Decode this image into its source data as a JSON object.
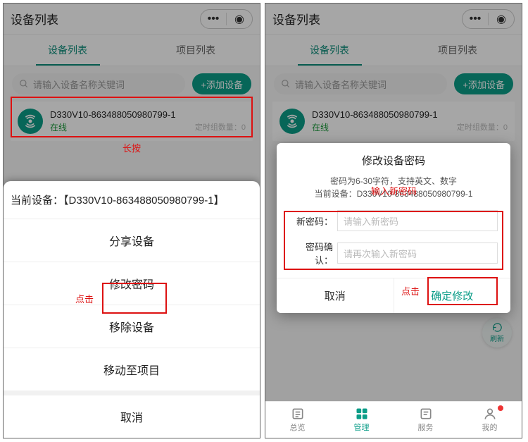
{
  "header": {
    "title": "设备列表"
  },
  "tabs": {
    "device": "设备列表",
    "project": "项目列表"
  },
  "search": {
    "placeholder": "请输入设备名称关键词"
  },
  "addButton": {
    "label": "+添加设备"
  },
  "device": {
    "name": "D330V10-863488050980799-1",
    "status": "在线",
    "timerLabel": "定时组数量：0"
  },
  "annotations": {
    "longPress": "长按",
    "click": "点击",
    "inputNewPwd": "输入新密码"
  },
  "sheet": {
    "titlePrefix": "当前设备：【",
    "titleName": "D330V10-863488050980799-1",
    "titleSuffix": "】",
    "share": "分享设备",
    "changePwd": "修改密码",
    "remove": "移除设备",
    "moveToProject": "移动至项目",
    "cancel": "取消"
  },
  "modal": {
    "title": "修改设备密码",
    "hintLine1": "密码为6-30字符，支持英文、数字",
    "hintLine2Prefix": "当前设备：",
    "hintLine2Name": "D330V10-863488050980799-1",
    "newPwdLabel": "新密码：",
    "newPwdPlaceholder": "请输入新密码",
    "confirmLabel": "密码确认：",
    "confirmPlaceholder": "请再次输入新密码",
    "cancel": "取消",
    "ok": "确定修改"
  },
  "refresh": {
    "label": "刷新"
  },
  "bottomTabs": {
    "overview": "总览",
    "manage": "管理",
    "service": "服务",
    "mine": "我的"
  }
}
